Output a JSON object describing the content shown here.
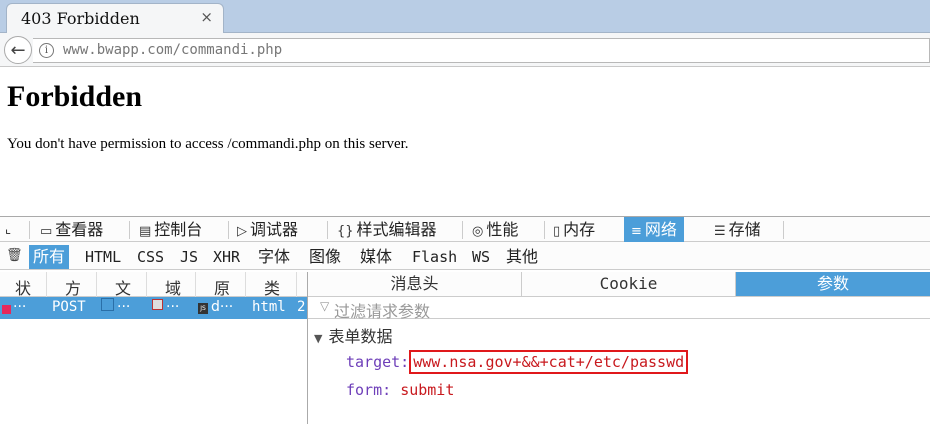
{
  "browser": {
    "tab_title": "403 Forbidden",
    "tab_close": "×",
    "back_glyph": "←",
    "info_glyph": "i",
    "url": "www.bwapp.com/commandi.php"
  },
  "page": {
    "title": "Forbidden",
    "message": "You don't have permission to access /commandi.php on this server."
  },
  "devtools": {
    "inspector_glyph": "⌞",
    "tools": [
      {
        "icon": "▭",
        "label": "查看器"
      },
      {
        "icon": "▤",
        "label": "控制台"
      },
      {
        "icon": "▷",
        "label": "调试器"
      },
      {
        "icon": "{}",
        "label": "样式编辑器"
      },
      {
        "icon": "◎",
        "label": "性能"
      },
      {
        "icon": "▯",
        "label": "内存"
      },
      {
        "icon": "≡",
        "label": "网络"
      },
      {
        "icon": "☰",
        "label": "存储"
      }
    ],
    "active_tool": "网络",
    "trash_glyph": "🗑",
    "filters": [
      "所有",
      "HTML",
      "CSS",
      "JS",
      "XHR",
      "字体",
      "图像",
      "媒体",
      "Flash",
      "WS",
      "其他"
    ],
    "active_filter": "所有"
  },
  "request_list": {
    "columns": [
      "状",
      "方",
      "文",
      "域",
      "原",
      "类"
    ],
    "row": {
      "status": "···",
      "method": "POST",
      "file": "···",
      "domain": "···",
      "cause": "d···",
      "type": "html",
      "transferred": "2"
    }
  },
  "details": {
    "tabs": [
      "消息头",
      "Cookie",
      "参数"
    ],
    "active_tab": "参数",
    "filter_placeholder": "过滤请求参数",
    "section_title": "表单数据",
    "params": [
      {
        "key": "target:",
        "value": "www.nsa.gov+&&+cat+/etc/passwd",
        "highlighted": true
      },
      {
        "key": "form:",
        "value": "submit",
        "highlighted": false
      }
    ]
  },
  "colors": {
    "accent": "#4c9ed9",
    "tabstrip": "#b9cde5",
    "status_error": "#e5295b",
    "param_key": "#6e3fb9",
    "param_value": "#c8191e",
    "highlight_box": "#e0181b"
  }
}
